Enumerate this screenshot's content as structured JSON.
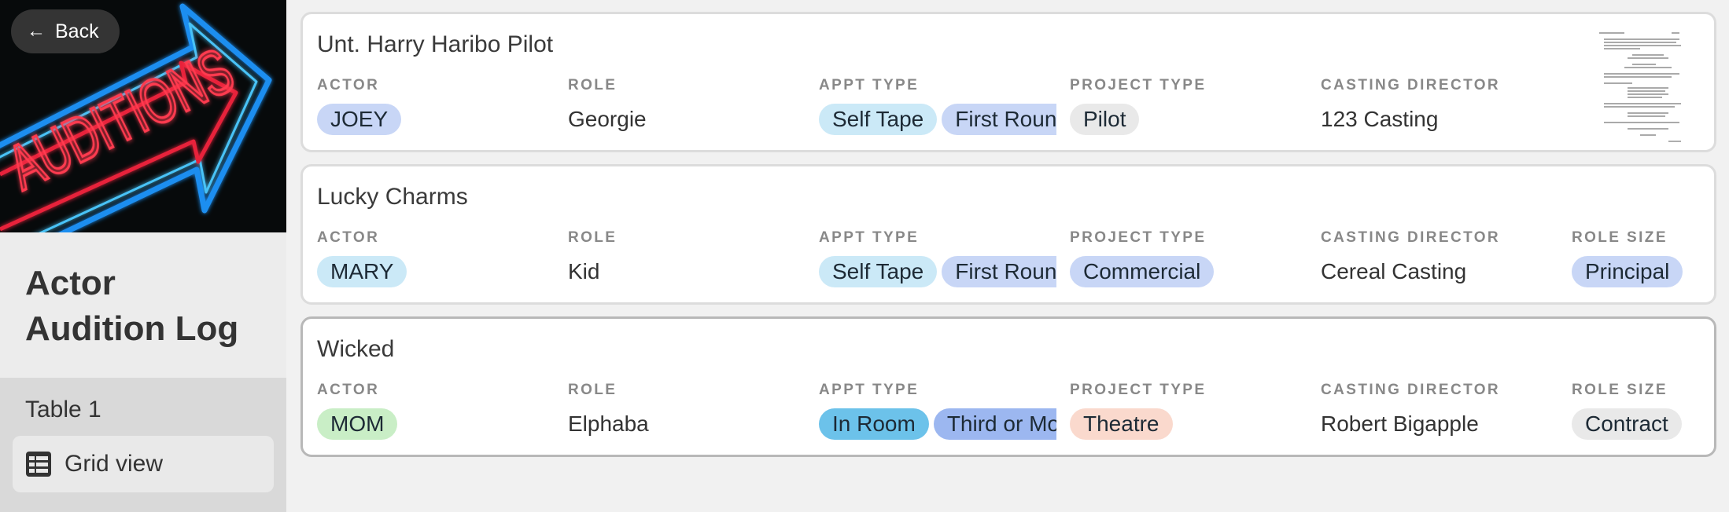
{
  "sidebar": {
    "back_label": "Back",
    "cover_text": "AUDITIONS",
    "app_title_line1": "Actor",
    "app_title_line2": "Audition Log",
    "table_name": "Table 1",
    "view_label": "Grid view"
  },
  "colors": {
    "pill_blue_light": "#cbe5f4",
    "pill_indigo": "#c8d6f6",
    "pill_gray": "#e9e9e9",
    "pill_green": "#c9eec6",
    "pill_cyan_strong": "#6cc2ea",
    "pill_blue_strong": "#9cb7f0",
    "pill_peach": "#fad9cd",
    "neon_red": "#e8213a",
    "neon_blue": "#1f8ef0"
  },
  "labels": {
    "actor": "Actor",
    "role": "Role",
    "appt_type": "Appt Type",
    "project_type": "Project Type",
    "casting_director": "Casting Director",
    "role_size": "Role Size"
  },
  "records": [
    {
      "title": "Unt. Harry Haribo Pilot",
      "actor": "JOEY",
      "role": "Georgie",
      "appt1": "Self Tape",
      "appt2": "First Round",
      "project_type": "Pilot",
      "casting_director": "123 Casting",
      "role_size": ""
    },
    {
      "title": "Lucky Charms",
      "actor": "MARY",
      "role": "Kid",
      "appt1": "Self Tape",
      "appt2": "First Round",
      "project_type": "Commercial",
      "casting_director": "Cereal Casting",
      "role_size": "Principal"
    },
    {
      "title": "Wicked",
      "actor": "MOM",
      "role": "Elphaba",
      "appt1": "In Room",
      "appt2": "Third or More",
      "project_type": "Theatre",
      "casting_director": "Robert Bigapple",
      "role_size": "Contract"
    }
  ]
}
